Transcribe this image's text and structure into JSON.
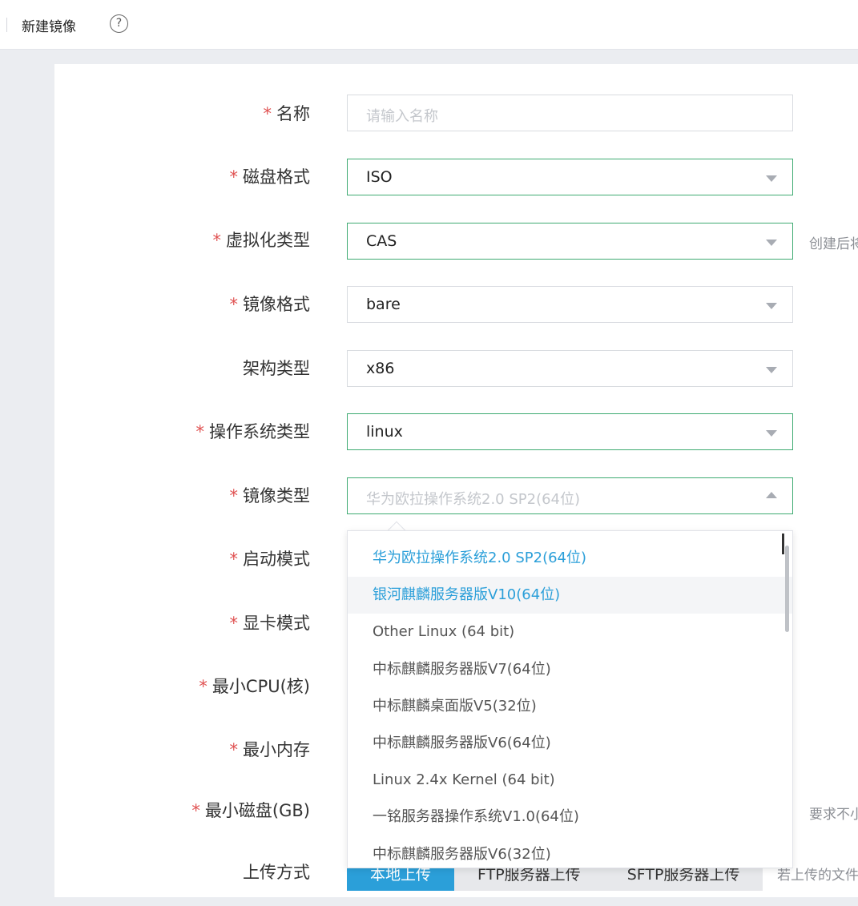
{
  "header": {
    "title": "新建镜像",
    "help": "?"
  },
  "form": {
    "name": {
      "label": "名称",
      "required": "*",
      "placeholder": "请输入名称"
    },
    "disk_format": {
      "label": "磁盘格式",
      "required": "*",
      "value": "ISO"
    },
    "virt_type": {
      "label": "虚拟化类型",
      "required": "*",
      "value": "CAS",
      "hint": "创建后将"
    },
    "image_format": {
      "label": "镜像格式",
      "required": "*",
      "value": "bare"
    },
    "arch": {
      "label": "架构类型",
      "value": "x86"
    },
    "os_type": {
      "label": "操作系统类型",
      "required": "*",
      "value": "linux"
    },
    "image_type": {
      "label": "镜像类型",
      "required": "*",
      "placeholder": "华为欧拉操作系统2.0 SP2(64位)"
    },
    "boot_mode": {
      "label": "启动模式",
      "required": "*"
    },
    "gpu_mode": {
      "label": "显卡模式",
      "required": "*"
    },
    "min_cpu": {
      "label": "最小CPU(核)",
      "required": "*"
    },
    "min_mem": {
      "label": "最小内存",
      "required": "*"
    },
    "min_disk": {
      "label": "最小磁盘(GB)",
      "required": "*",
      "hint": "要求不小"
    },
    "upload": {
      "label": "上传方式",
      "tabs": [
        "本地上传",
        "FTP服务器上传",
        "SFTP服务器上传"
      ],
      "hint": "若上传的文件"
    }
  },
  "dropdown": {
    "options": [
      "华为欧拉操作系统2.0 SP2(64位)",
      "银河麒麟服务器版V10(64位)",
      "Other Linux (64 bit)",
      "中标麒麟服务器版V7(64位)",
      "中标麒麟桌面版V5(32位)",
      "中标麒麟服务器版V6(64位)",
      "Linux 2.4x Kernel (64 bit)",
      "一铭服务器操作系统V1.0(64位)",
      "中标麒麟服务器版V6(32位)"
    ],
    "selected_index": 0,
    "hover_index": 1
  },
  "colors": {
    "accent": "#2b9fd9",
    "required": "#e05252",
    "focus_border": "#3fab72"
  }
}
